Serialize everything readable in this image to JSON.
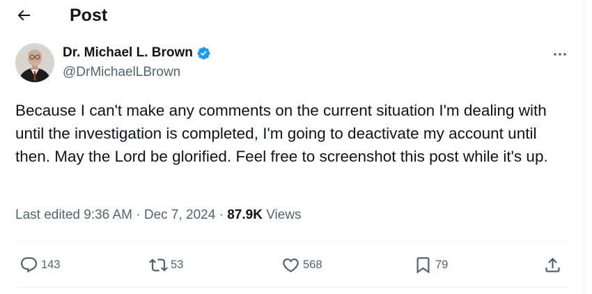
{
  "header": {
    "title": "Post",
    "back_icon": "arrow-left-icon"
  },
  "author": {
    "name": "Dr. Michael L. Brown",
    "handle": "@DrMichaelLBrown",
    "verified_icon": "verified-badge-icon",
    "verified_color": "#1d9bf0"
  },
  "post": {
    "text": "Because I can't make any comments on the current situation I'm dealing with until the investigation is completed, I'm going to deactivate my account until then. May the Lord be glorified. Feel free to screenshot this post while it's up."
  },
  "meta": {
    "edited_label": "Last edited",
    "time": "9:36 AM",
    "separator": "·",
    "date": "Dec 7, 2024",
    "views_count": "87.9K",
    "views_label": "Views"
  },
  "actions": {
    "replies": "143",
    "reposts": "53",
    "likes": "568",
    "bookmarks": "79"
  },
  "colors": {
    "text": "#0f1419",
    "secondary": "#536471",
    "divider": "#eff3f4",
    "accent": "#1d9bf0"
  }
}
